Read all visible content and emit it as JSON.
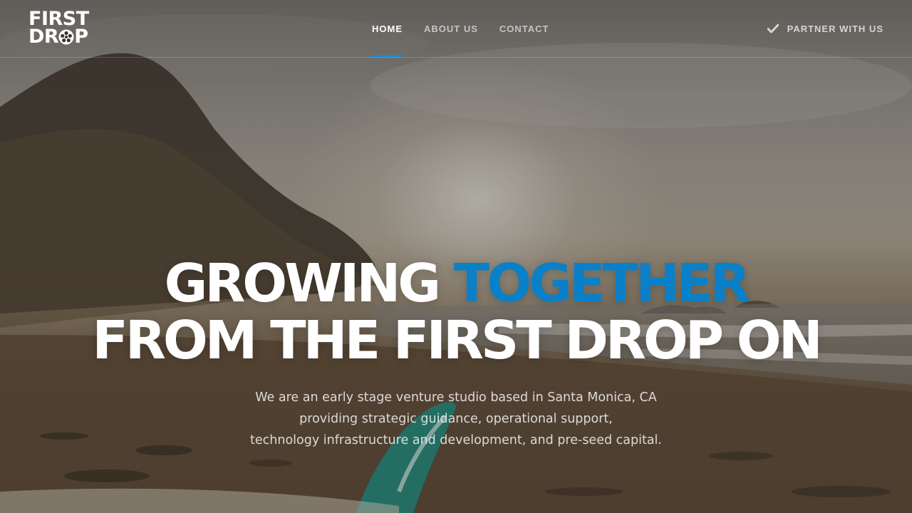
{
  "logo": {
    "line1": "FIRST",
    "line2_prefix": "DR",
    "line2_suffix": "P"
  },
  "nav": {
    "items": [
      {
        "label": "HOME",
        "active": true
      },
      {
        "label": "ABOUT US",
        "active": false
      },
      {
        "label": "CONTACT",
        "active": false
      }
    ]
  },
  "cta": {
    "label": "PARTNER WITH US",
    "icon": "check-icon"
  },
  "hero": {
    "headline_line1_white": "GROWING ",
    "headline_line1_accent": "TOGETHER",
    "headline_line2": "FROM THE FIRST DROP ON",
    "subtext_lines": [
      "We are an early stage venture studio based in Santa Monica, CA",
      "providing strategic guidance, operational support,",
      "technology infrastructure and development, and pre-seed capital."
    ]
  },
  "colors": {
    "accent": "#0a80c8",
    "nav_underline": "#1a8ad4",
    "text": "#ffffff"
  }
}
